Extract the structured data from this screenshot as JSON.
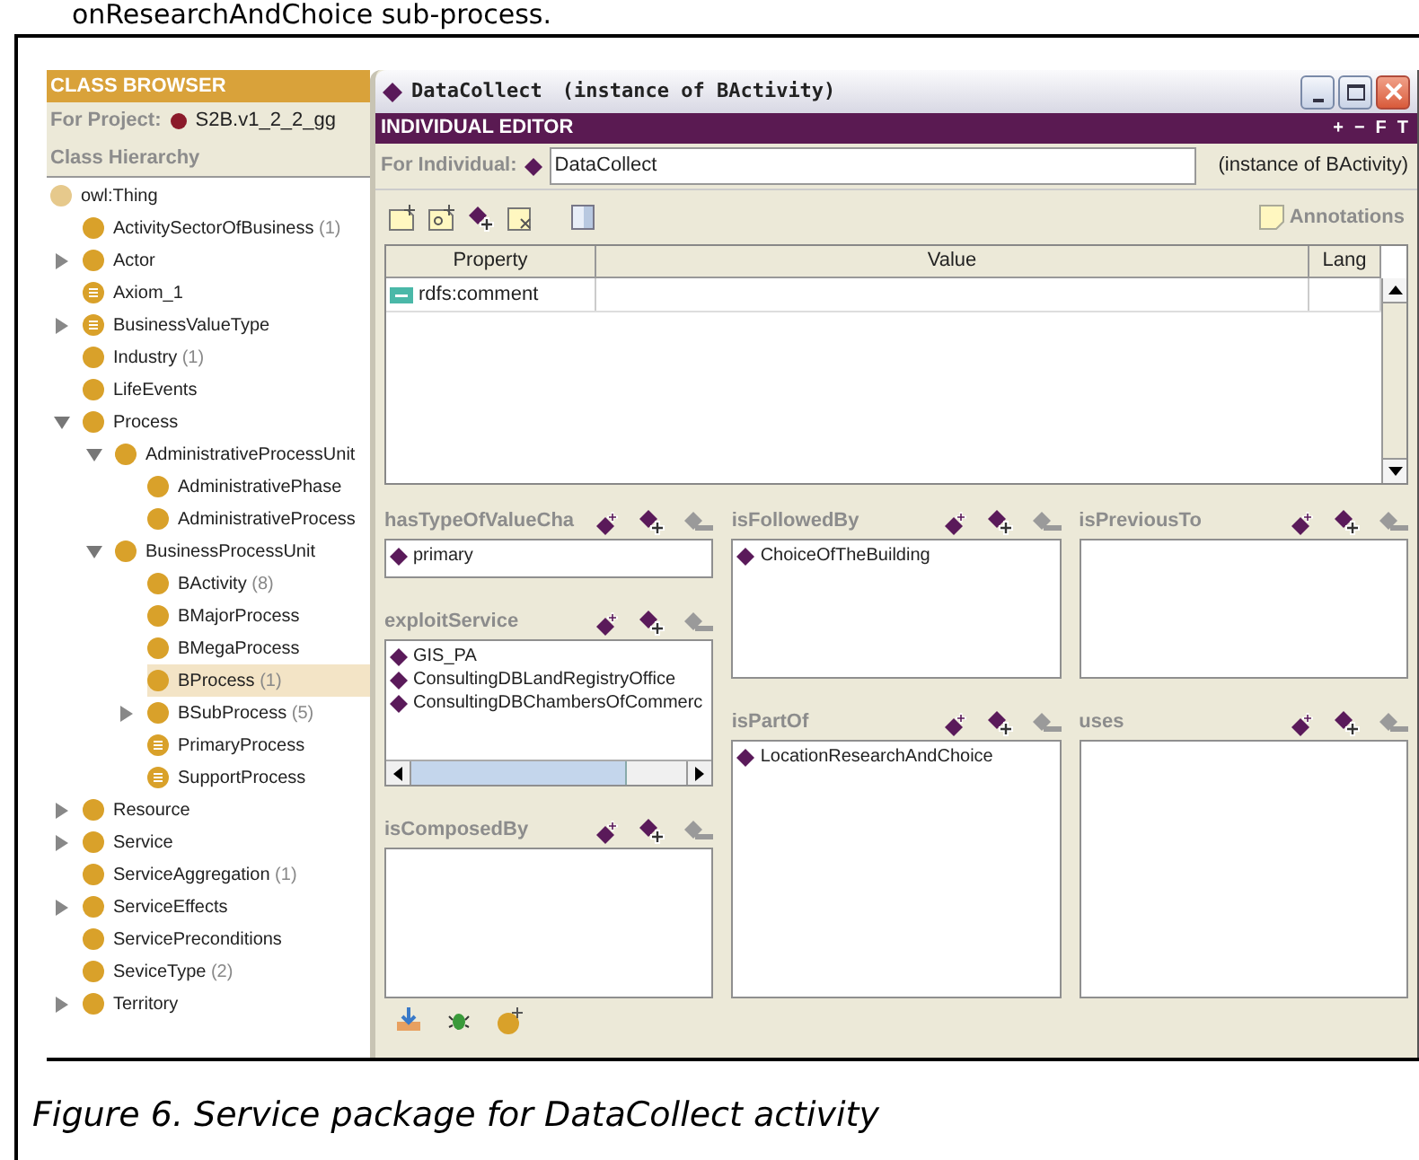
{
  "top_text": "onResearchAndChoice sub-process.",
  "class_browser": {
    "title": "CLASS BROWSER",
    "project_label": "For Project:",
    "project": "S2B.v1_2_2_gg",
    "hierarchy_title": "Class Hierarchy",
    "tree": [
      {
        "label": "owl:Thing",
        "kind": "root",
        "selected": false,
        "children": [
          {
            "label": "ActivitySectorOfBusiness",
            "count": "(1)",
            "kind": "class",
            "selected": false
          },
          {
            "label": "Actor",
            "kind": "class",
            "expanded": false,
            "selected": false
          },
          {
            "label": "Axiom_1",
            "kind": "defined",
            "selected": false
          },
          {
            "label": "BusinessValueType",
            "kind": "defined",
            "expanded": false,
            "selected": false
          },
          {
            "label": "Industry",
            "count": "(1)",
            "kind": "class",
            "selected": false
          },
          {
            "label": "LifeEvents",
            "kind": "class",
            "selected": false
          },
          {
            "label": "Process",
            "kind": "class",
            "expanded": true,
            "selected": false,
            "children": [
              {
                "label": "AdministrativeProcessUnit",
                "kind": "class",
                "expanded": true,
                "selected": false,
                "children": [
                  {
                    "label": "AdministrativePhase",
                    "kind": "class",
                    "selected": false
                  },
                  {
                    "label": "AdministrativeProcess",
                    "kind": "class",
                    "selected": false
                  }
                ]
              },
              {
                "label": "BusinessProcessUnit",
                "kind": "class",
                "expanded": true,
                "selected": false,
                "children": [
                  {
                    "label": "BActivity",
                    "count": "(8)",
                    "kind": "class",
                    "selected": false
                  },
                  {
                    "label": "BMajorProcess",
                    "kind": "class",
                    "selected": false
                  },
                  {
                    "label": "BMegaProcess",
                    "kind": "class",
                    "selected": false
                  },
                  {
                    "label": "BProcess",
                    "count": "(1)",
                    "kind": "class",
                    "selected": true
                  },
                  {
                    "label": "BSubProcess",
                    "count": "(5)",
                    "kind": "class",
                    "expanded": false,
                    "selected": false
                  },
                  {
                    "label": "PrimaryProcess",
                    "kind": "defined",
                    "selected": false
                  },
                  {
                    "label": "SupportProcess",
                    "kind": "defined",
                    "selected": false
                  }
                ]
              }
            ]
          },
          {
            "label": "Resource",
            "kind": "class",
            "expanded": false,
            "selected": false
          },
          {
            "label": "Service",
            "kind": "class",
            "expanded": false,
            "selected": false
          },
          {
            "label": "ServiceAggregation",
            "count": "(1)",
            "kind": "class",
            "selected": false
          },
          {
            "label": "ServiceEffects",
            "kind": "class",
            "expanded": false,
            "selected": false
          },
          {
            "label": "ServicePreconditions",
            "kind": "class",
            "selected": false
          },
          {
            "label": "SeviceType",
            "count": "(2)",
            "kind": "class",
            "selected": false
          },
          {
            "label": "Territory",
            "kind": "class",
            "expanded": false,
            "selected": false
          }
        ]
      }
    ]
  },
  "window": {
    "title": "DataCollect",
    "title_suffix": "(instance of BActivity)",
    "editor_title": "INDIVIDUAL EDITOR",
    "header_buttons": [
      "+",
      "−",
      "F",
      "T"
    ],
    "for_label": "For Individual:",
    "individual": "DataCollect",
    "instance_of": "(instance of BActivity)",
    "annotations": "Annotations",
    "table": {
      "columns": [
        "Property",
        "Value",
        "Lang"
      ],
      "rows": [
        {
          "property": "rdfs:comment"
        }
      ]
    },
    "slot_columns": [
      [
        {
          "name": "hasTypeOfValueCha",
          "kind": "single",
          "values": [
            "primary"
          ]
        },
        {
          "name": "exploitService",
          "kind": "scrolled",
          "values": [
            "GIS_PA",
            "ConsultingDBLandRegistryOffice",
            "ConsultingDBChambersOfCommerc"
          ]
        },
        {
          "name": "isComposedBy",
          "kind": "list"
        }
      ],
      [
        {
          "name": "isFollowedBy",
          "kind": "list",
          "values": [
            "ChoiceOfTheBuilding"
          ]
        },
        {
          "name": "isPartOf",
          "kind": "list",
          "values": [
            "LocationResearchAndChoice"
          ]
        }
      ],
      [
        {
          "name": "isPreviousTo",
          "kind": "list"
        },
        {
          "name": "uses",
          "kind": "list"
        }
      ]
    ]
  },
  "caption": "Figure 6. Service package for DataCollect activity"
}
